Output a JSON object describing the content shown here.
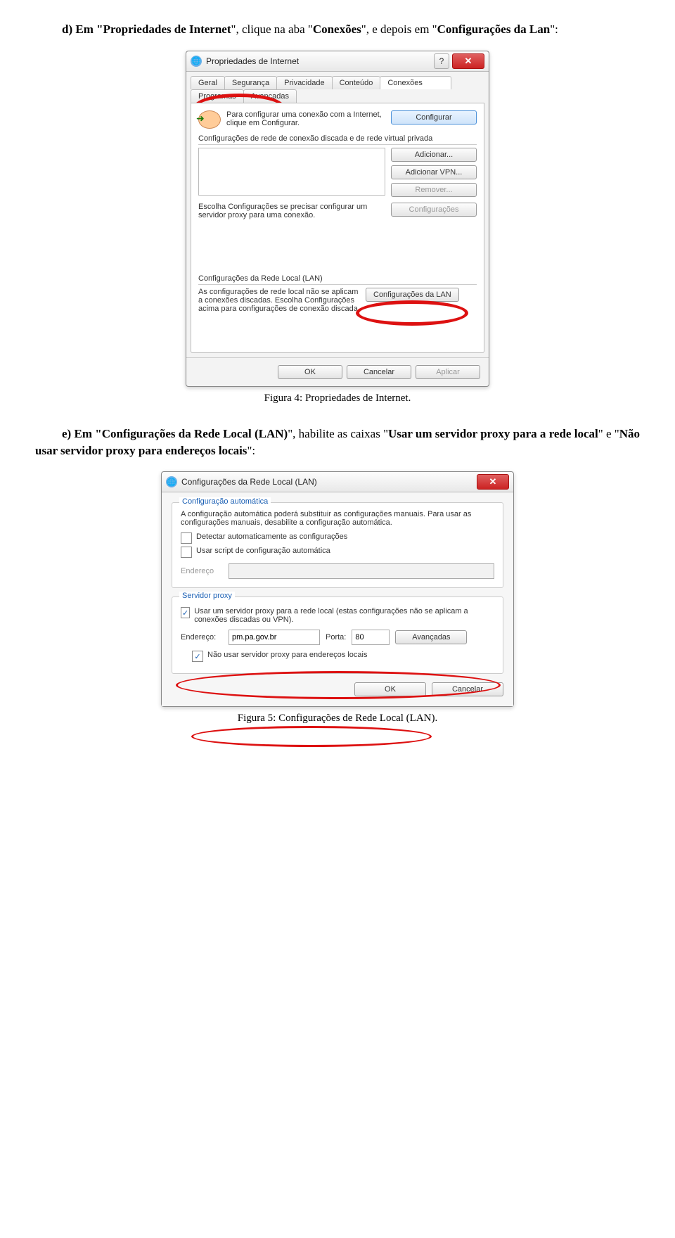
{
  "doc": {
    "p1_prefix": "d) Em \"",
    "p1_b1": "Propriedades de Internet",
    "p1_mid1": "\", clique na aba \"",
    "p1_b2": "Conexões",
    "p1_mid2": "\", e depois em \"",
    "p1_b3": "Configurações da Lan",
    "p1_suffix": "\":",
    "fig4_caption": "Figura 4: Propriedades de Internet.",
    "p2_prefix": "e) Em \"",
    "p2_b1": "Configurações da Rede Local (LAN)",
    "p2_mid1": "\", habilite as caixas \"",
    "p2_b2": "Usar um servidor proxy para a rede local",
    "p2_mid2": "\" e \"",
    "p2_b3": "Não usar servidor proxy para endereços locais",
    "p2_suffix": "\":",
    "fig5_caption": "Figura 5: Configurações de Rede Local (LAN)."
  },
  "dlg1": {
    "title": "Propriedades de Internet",
    "tabs_row1": [
      "Geral",
      "Segurança",
      "Privacidade",
      "Conteúdo"
    ],
    "tabs_row2": [
      "Conexões",
      "Programas",
      "Avançadas"
    ],
    "configure_text": "Para configurar uma conexão com a Internet, clique em Configurar.",
    "btn_configure": "Configurar",
    "dialup_label": "Configurações de rede de conexão discada e de rede virtual privada",
    "btn_add": "Adicionar...",
    "btn_addvpn": "Adicionar VPN...",
    "btn_remove": "Remover...",
    "proxy_note": "Escolha Configurações se precisar configurar um servidor proxy para uma conexão.",
    "btn_settings": "Configurações",
    "lan_label": "Configurações da Rede Local (LAN)",
    "lan_note": "As configurações de rede local não se aplicam a conexões discadas. Escolha Configurações acima para configurações de conexão discada.",
    "btn_lan": "Configurações da LAN",
    "btn_ok": "OK",
    "btn_cancel": "Cancelar",
    "btn_apply": "Aplicar"
  },
  "dlg2": {
    "title": "Configurações da Rede Local (LAN)",
    "group1_legend": "Configuração automática",
    "auto_desc": "A configuração automática poderá substituir as configurações manuais. Para usar as configurações manuais, desabilite a configuração automática.",
    "chk_detect": "Detectar automaticamente as configurações",
    "chk_script": "Usar script de configuração automática",
    "addr_label": "Endereço",
    "group2_legend": "Servidor proxy",
    "chk_proxy": "Usar um servidor proxy para a rede local (estas configurações não se aplicam a conexões discadas ou VPN).",
    "addr2_label": "Endereço:",
    "addr2_value": "pm.pa.gov.br",
    "port_label": "Porta:",
    "port_value": "80",
    "btn_advanced": "Avançadas",
    "chk_bypass": "Não usar servidor proxy para endereços locais",
    "btn_ok": "OK",
    "btn_cancel": "Cancelar"
  }
}
